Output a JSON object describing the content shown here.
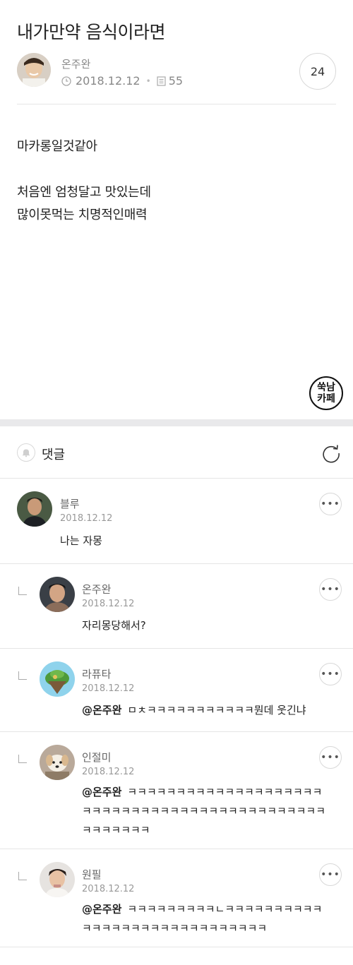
{
  "post": {
    "title": "내가만약 음식이라면",
    "author": "온주완",
    "date": "2018.12.12",
    "views": "55",
    "comment_count": "24",
    "body_lines": [
      "마카롱일것같아",
      "처음엔 엄청달고 맛있는데",
      "많이못먹는 치명적인매력"
    ],
    "stamp_line1": "쑥남",
    "stamp_line2": "카페"
  },
  "comments_header": {
    "label": "댓글"
  },
  "comments": [
    {
      "author": "블루",
      "date": "2018.12.12",
      "mention": "",
      "text": "나는 자몽"
    },
    {
      "author": "온주완",
      "date": "2018.12.12",
      "mention": "",
      "text": "자리몽당해서?"
    },
    {
      "author": "라퓨타",
      "date": "2018.12.12",
      "mention": "@온주완",
      "text": "ㅁㅊㅋㅋㅋㅋㅋㅋㅋㅋㅋㅋㅋ뭔데 웃긴냐"
    },
    {
      "author": "인절미",
      "date": "2018.12.12",
      "mention": "@온주완",
      "text": "ㅋㅋㅋㅋㅋㅋㅋㅋㅋㅋㅋㅋㅋㅋㅋㅋㅋㅋㅋㅋㅋㅋㅋㅋㅋㅋㅋㅋㅋㅋㅋㅋㅋㅋㅋㅋㅋㅋㅋㅋㅋㅋㅋㅋㅋㅋㅋㅋㅋㅋㅋㅋ"
    },
    {
      "author": "원필",
      "date": "2018.12.12",
      "mention": "@온주완",
      "text": "ㅋㅋㅋㅋㅋㅋㅋㅋㅋㄴㅋㅋㅋㅋㅋㅋㅋㅋㅋㅋㅋㅋㅋㅋㅋㅋㅋㅋㅋㅋㅋㅋㅋㅋㅋㅋㅋㅋㅋ"
    }
  ],
  "icons": {
    "clock": "clock-icon",
    "views": "document-icon",
    "bell": "bell-icon",
    "refresh": "refresh-icon",
    "more": "more-options-icon",
    "reply": "reply-indent-icon"
  }
}
